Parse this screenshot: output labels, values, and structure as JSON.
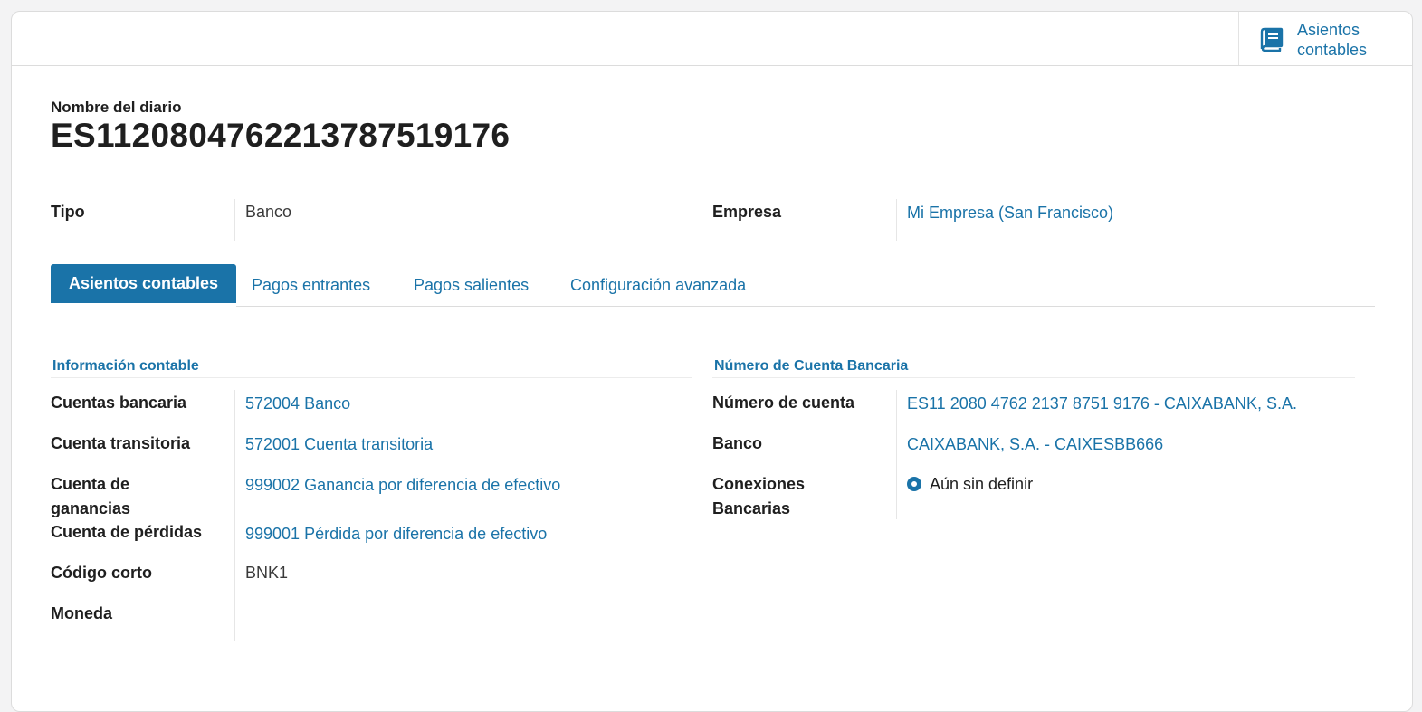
{
  "smart_button": {
    "label": "Asientos contables",
    "icon": "book-icon"
  },
  "header": {
    "name_label": "Nombre del diario",
    "name_value": "ES1120804762213787519176"
  },
  "top_fields": {
    "tipo_label": "Tipo",
    "tipo_value": "Banco",
    "empresa_label": "Empresa",
    "empresa_value": "Mi Empresa (San Francisco)"
  },
  "tabs": [
    {
      "label": "Asientos contables",
      "active": true
    },
    {
      "label": "Pagos entrantes",
      "active": false
    },
    {
      "label": "Pagos salientes",
      "active": false
    },
    {
      "label": "Configuración avanzada",
      "active": false
    }
  ],
  "accounting": {
    "title": "Información contable",
    "fields": [
      {
        "label": "Cuentas bancaria",
        "value": "572004 Banco"
      },
      {
        "label": "Cuenta transitoria",
        "value": "572001 Cuenta transitoria"
      },
      {
        "label": "Cuenta de ganancias",
        "value": "999002 Ganancia por diferencia de efectivo"
      },
      {
        "label": "Cuenta de pérdidas",
        "value": "999001 Pérdida por diferencia de efectivo"
      },
      {
        "label": "Código corto",
        "value": "BNK1"
      },
      {
        "label": "Moneda",
        "value": ""
      }
    ]
  },
  "bank_account": {
    "title": "Número de Cuenta Bancaria",
    "fields": [
      {
        "label": "Número de cuenta",
        "value": "ES11 2080 4762 2137 8751 9176 - CAIXABANK, S.A."
      },
      {
        "label": "Banco",
        "value": "CAIXABANK, S.A. - CAIXESBB666"
      },
      {
        "label": "Conexiones Bancarias",
        "value": "Aún sin definir"
      }
    ]
  },
  "colors": {
    "accent": "#1a73a8",
    "text": "#1f1f1f",
    "border": "#dcdcdc"
  }
}
